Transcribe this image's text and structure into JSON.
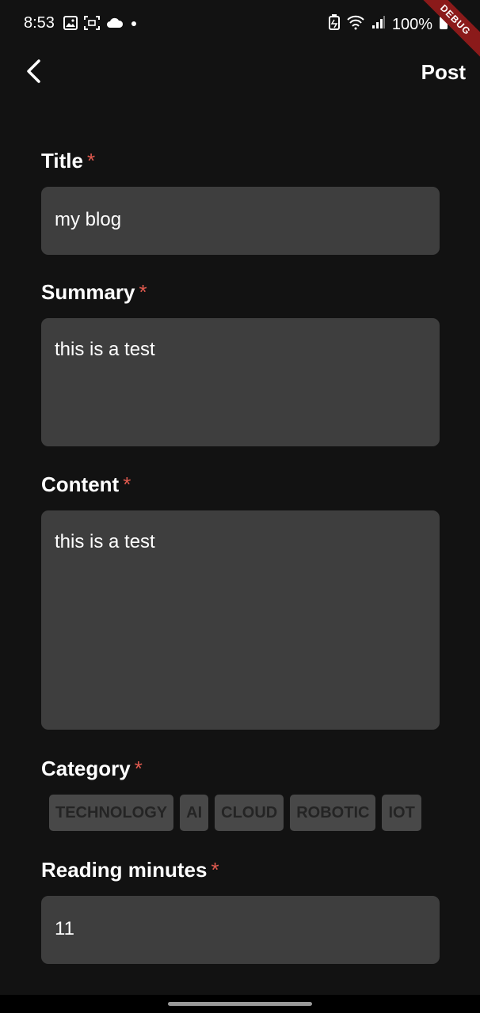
{
  "status_bar": {
    "time": "8:53",
    "battery": "100%",
    "icons_left": [
      "image-icon",
      "screenshot-icon",
      "cloud-icon",
      "dot-icon"
    ],
    "icons_right": [
      "battery-saver-icon",
      "wifi-icon",
      "signal-icon",
      "battery-icon"
    ]
  },
  "debug_banner": "DEBUG",
  "app_bar": {
    "back_icon": "chevron-left-icon",
    "action_label": "Post"
  },
  "form": {
    "required_mark": "*",
    "title": {
      "label": "Title",
      "value": "my blog"
    },
    "summary": {
      "label": "Summary",
      "value": "this is a test"
    },
    "content": {
      "label": "Content",
      "value": "this is a test"
    },
    "category": {
      "label": "Category",
      "options": [
        "TECHNOLOGY",
        "AI",
        "CLOUD",
        "ROBOTIC",
        "IOT"
      ]
    },
    "reading_minutes": {
      "label": "Reading minutes",
      "value": "11"
    }
  },
  "colors": {
    "background": "#121212",
    "field_background": "#3e3e3e",
    "required": "#e05a4f",
    "chip_background": "#484848",
    "chip_text": "#242424",
    "debug_ribbon": "#8b1a1a"
  }
}
